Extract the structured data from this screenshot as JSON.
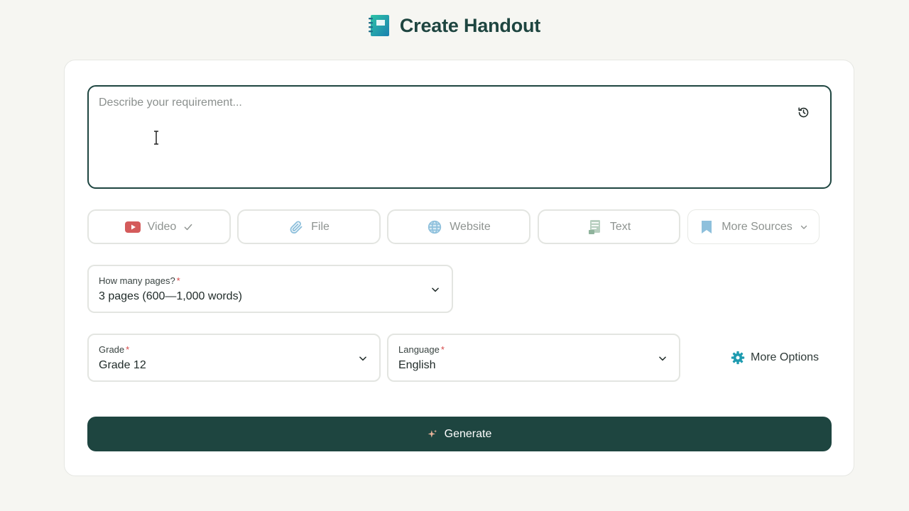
{
  "header": {
    "title": "Create Handout",
    "icon": "notebook-icon"
  },
  "prompt": {
    "placeholder": "Describe your requirement...",
    "value": "",
    "history_icon": "history-icon"
  },
  "sources": [
    {
      "label": "Video",
      "icon": "youtube-icon",
      "selected": true
    },
    {
      "label": "File",
      "icon": "paperclip-icon"
    },
    {
      "label": "Website",
      "icon": "globe-icon"
    },
    {
      "label": "Text",
      "icon": "document-icon"
    },
    {
      "label": "More Sources",
      "icon": "bookmark-icon"
    }
  ],
  "pages": {
    "label": "How many pages?",
    "required_mark": "*",
    "value": "3 pages (600—1,000 words)"
  },
  "grade": {
    "label": "Grade",
    "required_mark": "*",
    "value": "Grade 12"
  },
  "language": {
    "label": "Language",
    "required_mark": "*",
    "value": "English"
  },
  "more_options": {
    "label": "More Options",
    "icon": "gear-icon"
  },
  "generate": {
    "label": "Generate",
    "icon": "sparkle-icon"
  },
  "colors": {
    "primary": "#1e4540",
    "required": "#d64848",
    "youtube": "#d45b5b"
  }
}
